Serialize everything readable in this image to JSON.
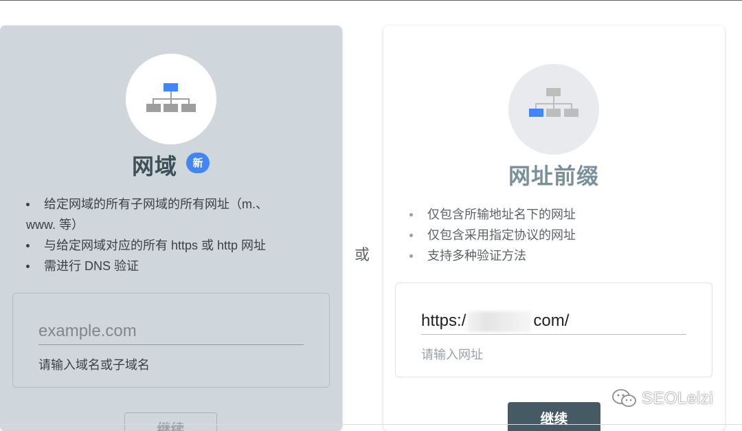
{
  "separator": {
    "label": "或"
  },
  "domain_card": {
    "title": "网域",
    "badge": "新",
    "icon": "sitemap-icon-top-highlight",
    "bullets": [
      {
        "text": "给定网域的所有子网域的所有网址（m.、",
        "continuation": "www. 等）"
      },
      {
        "text": "与给定网域对应的所有 https 或 http 网址"
      },
      {
        "text": "需进行 DNS 验证"
      }
    ],
    "input": {
      "value": "",
      "placeholder": "example.com",
      "helper": "请输入域名或子域名"
    },
    "button_label": "继续"
  },
  "prefix_card": {
    "title": "网址前缀",
    "icon": "sitemap-icon-bottom-left-highlight",
    "bullets": [
      {
        "text": "仅包含所输地址名下的网址"
      },
      {
        "text": "仅包含采用指定协议的网址"
      },
      {
        "text": "支持多种验证方法"
      }
    ],
    "input": {
      "value_prefix": "https:/",
      "value_suffix": "com/",
      "helper": "请输入网址"
    },
    "button_label": "继续"
  },
  "watermark": {
    "text": "SEOLeizi",
    "icon": "wechat-icon"
  },
  "colors": {
    "accent_blue": "#4285f4",
    "dark_button": "#455a64",
    "left_card_bg": "#d0d7dc"
  }
}
